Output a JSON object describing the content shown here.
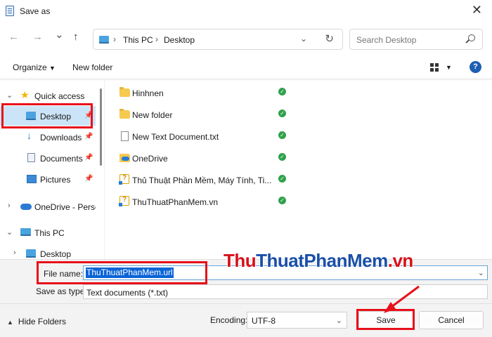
{
  "window": {
    "title": "Save as"
  },
  "navbar": {
    "back": "←",
    "forward": "→",
    "recent": "⌄",
    "up": "↑",
    "breadcrumb": [
      "This PC",
      "Desktop"
    ],
    "search_placeholder": "Search Desktop"
  },
  "commandbar": {
    "organize": "Organize",
    "new_folder": "New folder",
    "help": "?"
  },
  "sidebar": {
    "items": [
      {
        "label": "Quick access",
        "icon": "star-icon",
        "chevron": "⌄"
      },
      {
        "label": "Desktop",
        "icon": "desktop-icon",
        "pinned": true
      },
      {
        "label": "Downloads",
        "icon": "download-icon",
        "pinned": true
      },
      {
        "label": "Documents",
        "icon": "documents-icon",
        "pinned": true
      },
      {
        "label": "Pictures",
        "icon": "pictures-icon",
        "pinned": true
      },
      {
        "label": "OneDrive - Perso",
        "icon": "onedrive-icon",
        "chevron": "›"
      },
      {
        "label": "This PC",
        "icon": "pc-icon",
        "chevron": "⌄"
      },
      {
        "label": "Desktop",
        "icon": "desktop-icon",
        "chevron": "›"
      }
    ]
  },
  "files": [
    {
      "name": "Hinhnen",
      "type": "folder"
    },
    {
      "name": "New folder",
      "type": "folder"
    },
    {
      "name": "New Text Document.txt",
      "type": "text"
    },
    {
      "name": "OneDrive",
      "type": "onedrive-folder"
    },
    {
      "name": "Thủ Thuật Phần Mềm, Máy Tính, Ti...",
      "type": "shortcut"
    },
    {
      "name": "ThuThuatPhanMem.vn",
      "type": "shortcut"
    }
  ],
  "form": {
    "file_name_label": "File name:",
    "file_name_value": "ThuThuatPhanMem.url",
    "save_type_label": "Save as type:",
    "save_type_value": "Text documents (*.txt)"
  },
  "footer": {
    "hide_folders": "Hide Folders",
    "encoding_label": "Encoding:",
    "encoding_value": "UTF-8",
    "save": "Save",
    "cancel": "Cancel"
  },
  "watermark": {
    "part1": "Thu",
    "part2": "ThuatPhanMem",
    "part3": ".vn"
  },
  "colors": {
    "highlight": "#e8101a",
    "selection": "#cce4f7",
    "accent": "#0a64d6",
    "status_ok": "#2fa14b"
  }
}
